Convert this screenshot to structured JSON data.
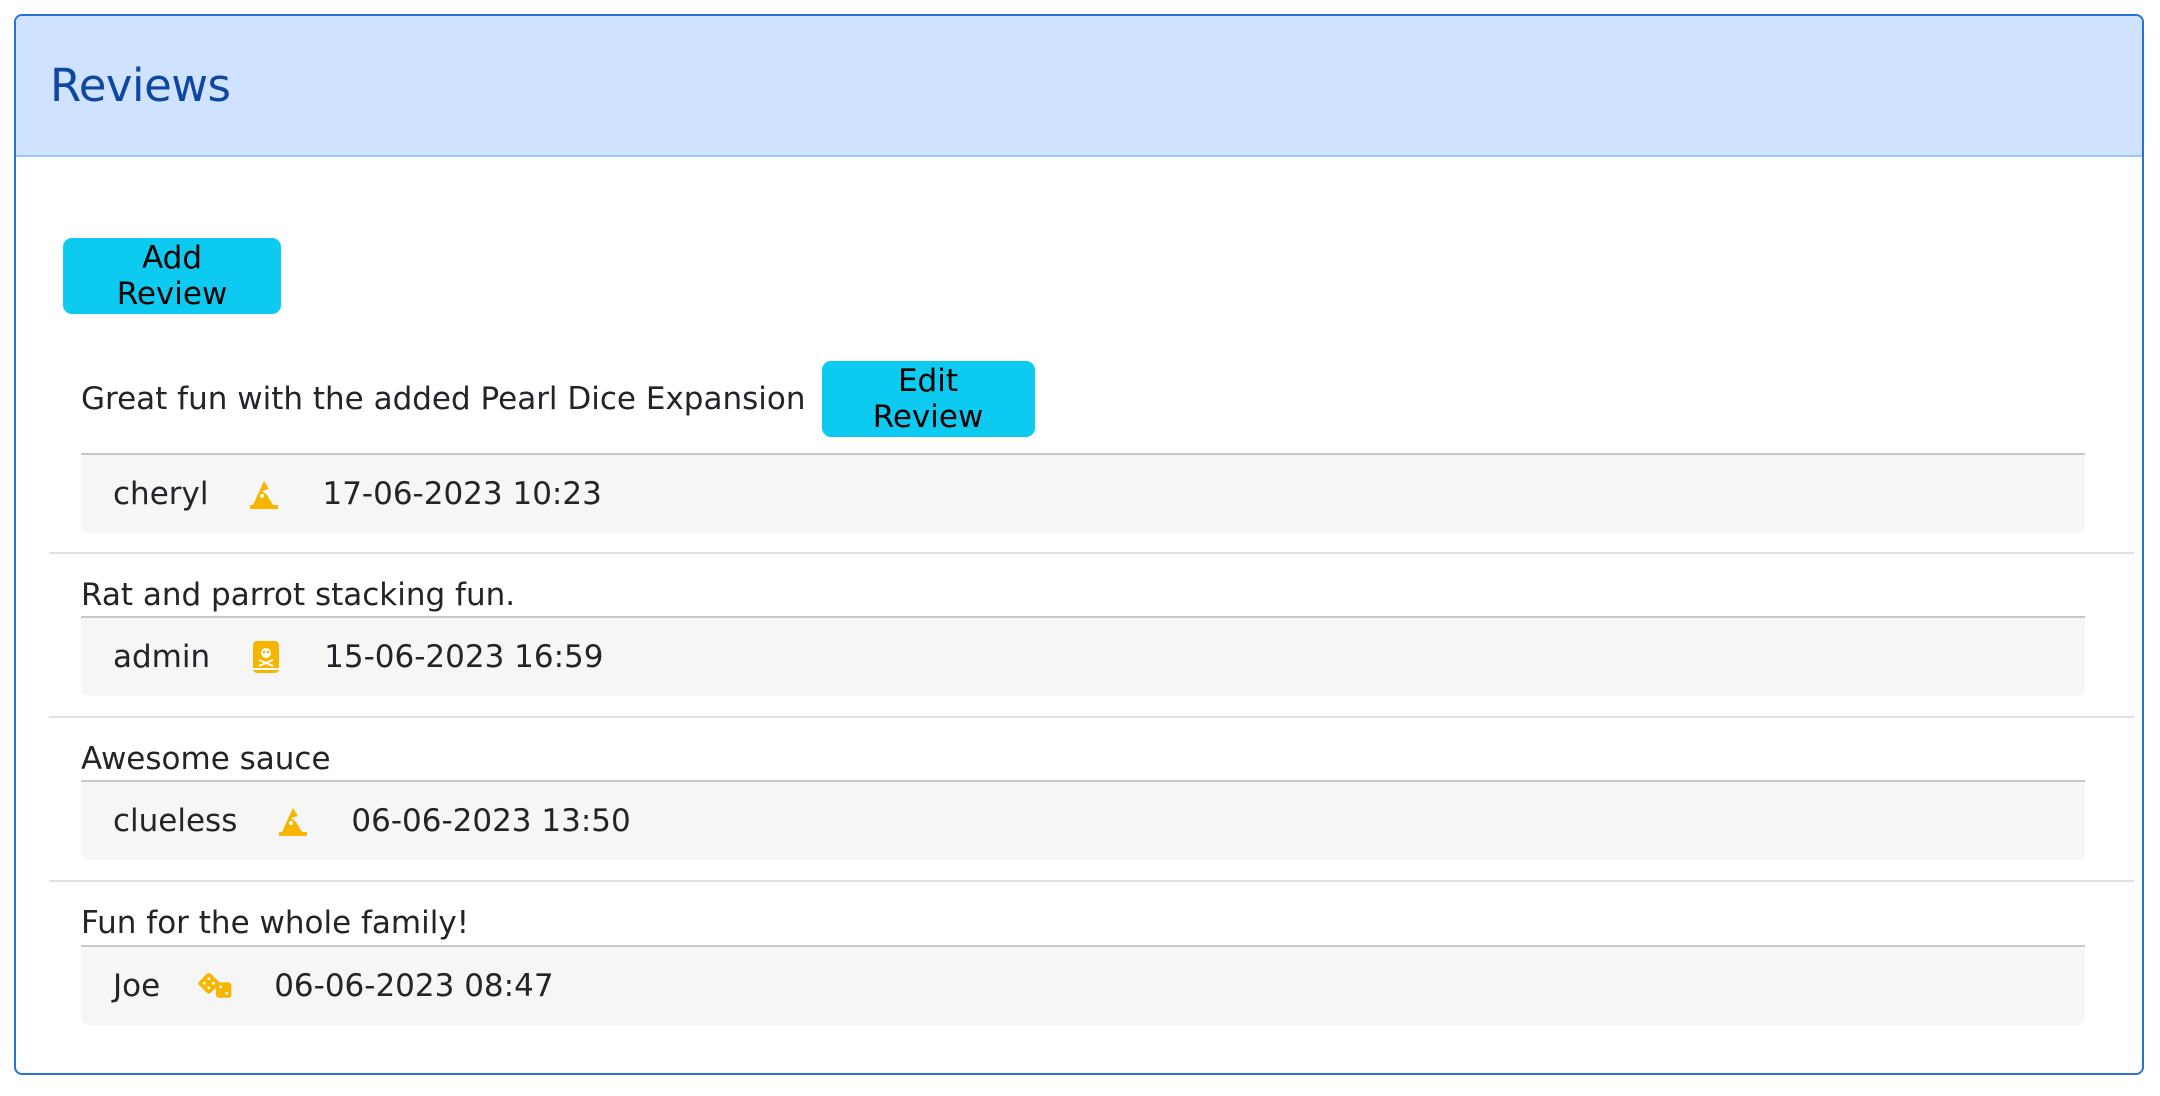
{
  "header": {
    "title": "Reviews"
  },
  "actions": {
    "add_review_label": "Add Review",
    "edit_review_label": "Edit Review"
  },
  "colors": {
    "header_bg": "#cfe2ff",
    "title": "#0d47a1",
    "button": "#0dcaf0",
    "icon": "#f7b500"
  },
  "reviews": [
    {
      "text": "Great fun with the added Pearl Dice Expansion",
      "user": "cheryl",
      "icon": "wizard-hat-icon",
      "date": "17-06-2023 10:23",
      "editable": true
    },
    {
      "text": "Rat and parrot stacking fun.",
      "user": "admin",
      "icon": "pirate-book-icon",
      "date": "15-06-2023 16:59",
      "editable": false
    },
    {
      "text": "Awesome sauce",
      "user": "clueless",
      "icon": "wizard-hat-icon",
      "date": "06-06-2023 13:50",
      "editable": false
    },
    {
      "text": "Fun for the whole family!",
      "user": "Joe",
      "icon": "dice-icon",
      "date": "06-06-2023 08:47",
      "editable": false
    }
  ]
}
